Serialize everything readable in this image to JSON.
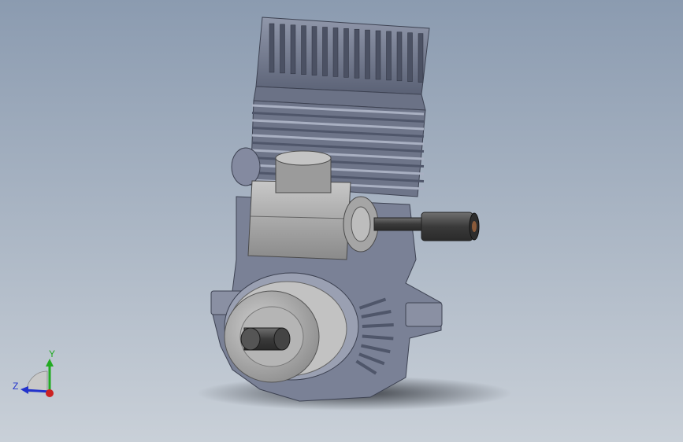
{
  "viewport": {
    "background_top": "#8b9bb0",
    "background_bottom": "#c9d0d8"
  },
  "model": {
    "body_color": "#7e869c",
    "body_shadow": "#4f566a",
    "body_highlight": "#a9b0c2",
    "part_gray": "#8c8c8c",
    "part_dark": "#3e3e3e"
  },
  "triad": {
    "y_label": "Y",
    "z_label": "Z",
    "y_color": "#22aa22",
    "z_color": "#2233cc",
    "x_color": "#cc2222"
  }
}
